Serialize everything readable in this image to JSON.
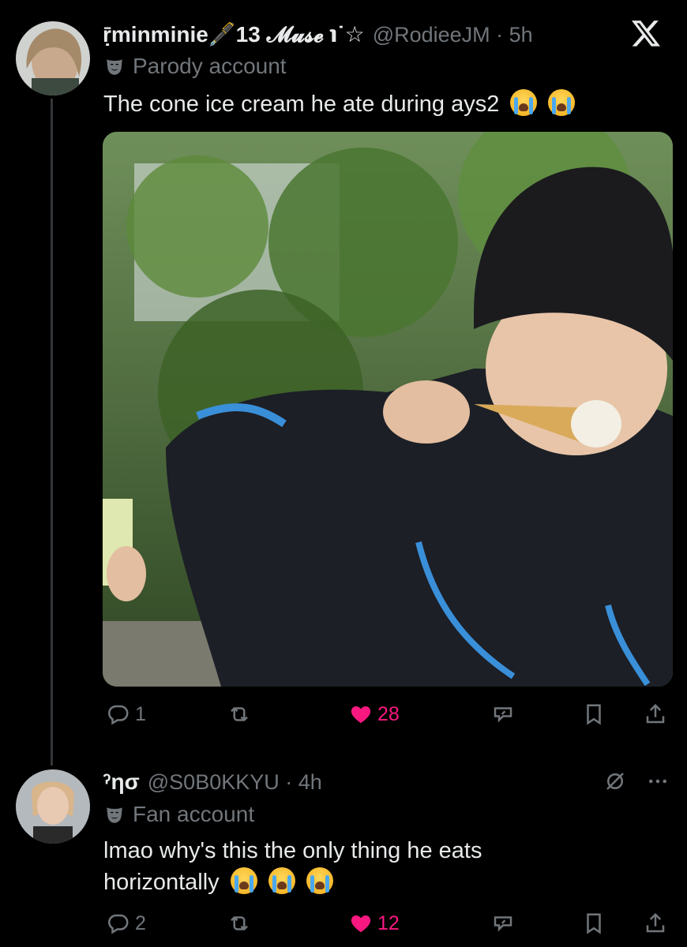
{
  "tweet1": {
    "display_name": "ṝminminie🖋️13 𝓜𝓾𝓼𝓮 ℩˙☆",
    "handle_time": "@RodieeJM · 5h",
    "badge": "Parody account",
    "text": "The cone ice cream he ate during ays2",
    "reply_count": "1",
    "retweet_count": "",
    "like_count": "28"
  },
  "tweet2": {
    "display_name": "ˀησ",
    "handle_time": "@S0B0KKYU · 4h",
    "badge": "Fan account",
    "text_line1": "lmao why's this the only thing he eats",
    "text_line2": "horizontally",
    "reply_count": "2",
    "retweet_count": "",
    "like_count": "12"
  },
  "colors": {
    "like": "#f91880",
    "muted": "#71767b",
    "text": "#e7e9ea",
    "bg": "#000000"
  },
  "icons": [
    "x-logo-icon",
    "parody-mask-icon",
    "reply-icon",
    "retweet-icon",
    "heart-icon",
    "grok-icon",
    "bookmark-icon",
    "share-icon",
    "more-icon",
    "mute-icon",
    "crying-emoji-icon"
  ]
}
